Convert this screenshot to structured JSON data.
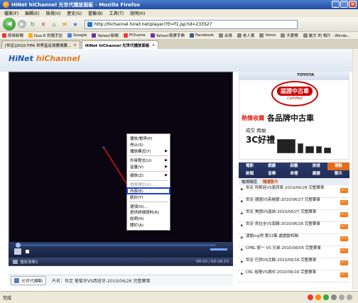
{
  "window": {
    "title": "HiNet hiChannel 光世代播放面板 - Mozilla Firefox"
  },
  "menu": [
    "檔案(F)",
    "編輯(E)",
    "檢視(V)",
    "歷史(S)",
    "書籤(B)",
    "工具(T)",
    "說明(H)"
  ],
  "address": {
    "url": "http://hichannel.hinet.net/player/?tt=f1.jsp?id=233527"
  },
  "bookmarks": [
    "即時新聞",
    "Duo E 的隨手記",
    "Google",
    "Yahoo!新聞",
    "PChome",
    "Yahoo!奇摩字典",
    "Facebook",
    "台灣",
    "老人黨",
    "Volvo",
    "不愛榜",
    "敏文 的 相片 - Windo..."
  ],
  "tabs": [
    {
      "label": "[世足]2010 FIFA 世界盃足球賽揭賽...",
      "active": false
    },
    {
      "label": "HiNet hiChannel 光世代播放面板",
      "active": true
    }
  ],
  "page": {
    "logo_main": "HiNet",
    "logo_sub": "hiChannel",
    "player_status": "播放清單2",
    "player_time": "00:10 / 02:16:15",
    "bottom_channel": "光世代轉動",
    "bottom_title": "片名：世足 葡萄牙VS西班牙-2010/06/26 完整賽事"
  },
  "context_menu": [
    {
      "label": "播放/暫停(P)",
      "submenu": false,
      "enabled": true
    },
    {
      "label": "停止(S)",
      "submenu": false,
      "enabled": true
    },
    {
      "label": "播放模式(Y)",
      "submenu": true,
      "enabled": true
    },
    {
      "sep": true
    },
    {
      "label": "外掛程式(U)",
      "submenu": true,
      "enabled": true
    },
    {
      "label": "音量(V)",
      "submenu": true,
      "enabled": true
    },
    {
      "sep": true
    },
    {
      "label": "縮放(Z)",
      "submenu": true,
      "enabled": true
    },
    {
      "sep": true
    },
    {
      "label": "檔案標記(K)...",
      "submenu": false,
      "enabled": false
    },
    {
      "label": "內容(E)",
      "submenu": false,
      "enabled": true,
      "highlighted": true
    },
    {
      "label": "統計(T)",
      "submenu": false,
      "enabled": true
    },
    {
      "sep": true
    },
    {
      "label": "選項(O)...",
      "submenu": false,
      "enabled": true
    },
    {
      "label": "提供詳細資料(R)",
      "submenu": false,
      "enabled": true
    },
    {
      "label": "說明(H)",
      "submenu": false,
      "enabled": true
    },
    {
      "label": "關於(A)",
      "submenu": false,
      "enabled": true
    }
  ],
  "sidebar": {
    "ad": {
      "brand": "TOYOTA",
      "badge": "認證中古車",
      "badge_sub": "Certified",
      "headline_red": "熱情收購",
      "headline_big": "各品牌中古車",
      "line2": "成交 再抽",
      "line3": "3C好禮"
    },
    "tab_row1": [
      "電影",
      "戲劇",
      "綜藝",
      "旅遊",
      "運動"
    ],
    "tab_row2": [
      "新聞",
      "音樂",
      "命理",
      "廣播",
      "聊天"
    ],
    "subtabs": [
      "電視頻道",
      "隨選影片"
    ],
    "videos": [
      {
        "title": "世足 阿根廷VS墨西哥-2010/06/28 完整賽事"
      },
      {
        "title": "世足 德國VS英格蘭-2010/06/27 完整賽事"
      },
      {
        "title": "世足 美國VS迦納-2010/06/27 完整賽事"
      },
      {
        "title": "世足 烏拉圭VS南韓-2010/06/26 完整賽事"
      },
      {
        "title": "運動ing吧.第22集 處處動特輯"
      },
      {
        "title": "CPBL 統一 VS 兄弟-2010/06/05 完整賽事"
      },
      {
        "title": "世足 巴西VS北韓-2010/06/16 完整賽事"
      },
      {
        "title": "CBL 裕隆VS達欣-2010/06/16 完整賽事"
      }
    ],
    "add_label": "+☆"
  },
  "status": {
    "text": "完成"
  }
}
